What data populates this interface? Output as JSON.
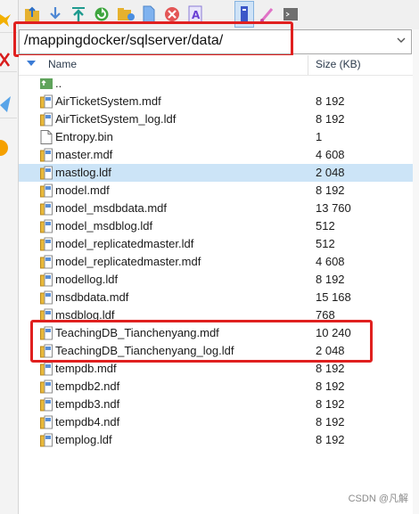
{
  "path": {
    "value": "/mappingdocker/sqlserver/data/"
  },
  "columns": {
    "name": "Name",
    "size": "Size (KB)"
  },
  "parent_label": "..",
  "files": [
    {
      "name": "AirTicketSystem.mdf",
      "size": "8 192",
      "icon": "db-file-icon"
    },
    {
      "name": "AirTicketSystem_log.ldf",
      "size": "8 192",
      "icon": "db-file-icon"
    },
    {
      "name": "Entropy.bin",
      "size": "1",
      "icon": "blank-file-icon"
    },
    {
      "name": "master.mdf",
      "size": "4 608",
      "icon": "db-file-icon"
    },
    {
      "name": "mastlog.ldf",
      "size": "2 048",
      "icon": "db-file-icon"
    },
    {
      "name": "model.mdf",
      "size": "8 192",
      "icon": "db-file-icon"
    },
    {
      "name": "model_msdbdata.mdf",
      "size": "13 760",
      "icon": "db-file-icon"
    },
    {
      "name": "model_msdblog.ldf",
      "size": "512",
      "icon": "db-file-icon"
    },
    {
      "name": "model_replicatedmaster.ldf",
      "size": "512",
      "icon": "db-file-icon"
    },
    {
      "name": "model_replicatedmaster.mdf",
      "size": "4 608",
      "icon": "db-file-icon"
    },
    {
      "name": "modellog.ldf",
      "size": "8 192",
      "icon": "db-file-icon"
    },
    {
      "name": "msdbdata.mdf",
      "size": "15 168",
      "icon": "db-file-icon"
    },
    {
      "name": "msdblog.ldf",
      "size": "768",
      "icon": "db-file-icon"
    },
    {
      "name": "TeachingDB_Tianchenyang.mdf",
      "size": "10 240",
      "icon": "db-file-icon"
    },
    {
      "name": "TeachingDB_Tianchenyang_log.ldf",
      "size": "2 048",
      "icon": "db-file-icon"
    },
    {
      "name": "tempdb.mdf",
      "size": "8 192",
      "icon": "db-file-icon"
    },
    {
      "name": "tempdb2.ndf",
      "size": "8 192",
      "icon": "db-file-icon"
    },
    {
      "name": "tempdb3.ndf",
      "size": "8 192",
      "icon": "db-file-icon"
    },
    {
      "name": "tempdb4.ndf",
      "size": "8 192",
      "icon": "db-file-icon"
    },
    {
      "name": "templog.ldf",
      "size": "8 192",
      "icon": "db-file-icon"
    }
  ],
  "selected_row": "mastlog.ldf",
  "toolbar_icons": [
    "folder-up-icon",
    "download-icon",
    "upload-top-icon",
    "refresh-icon",
    "open-folder-icon",
    "new-file-icon",
    "delete-icon",
    "rename-icon",
    "edit-icon",
    "pen-icon",
    "terminal-icon"
  ],
  "watermark": "CSDN @凡解",
  "colors": {
    "highlight": "#e0201f",
    "selection": "#cce4f7",
    "accent": "#3a7bd5"
  }
}
